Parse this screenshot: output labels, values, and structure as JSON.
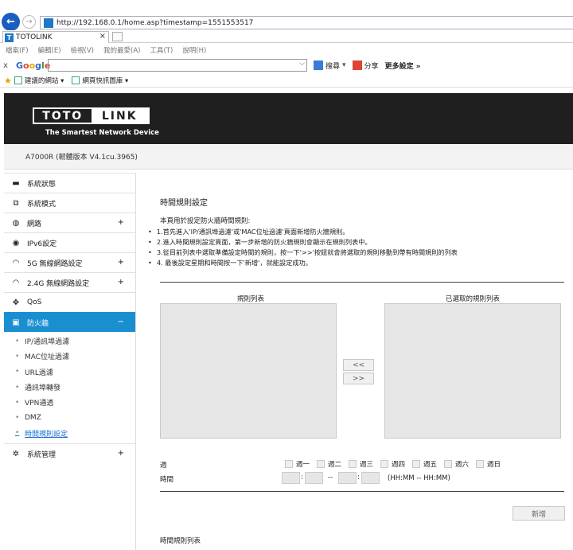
{
  "browser": {
    "url": "http://192.168.0.1/home.asp?timestamp=1551553517",
    "tab_title": "TOTOLINK",
    "tab_icon": "T",
    "tab_close": "×",
    "menu": [
      "檔案(F)",
      "編輯(E)",
      "檢視(V)",
      "我的最愛(A)",
      "工具(T)",
      "說明(H)"
    ],
    "google": {
      "close": "x",
      "logo": [
        "G",
        "o",
        "o",
        "g",
        "l",
        "e"
      ],
      "search_value": "",
      "search_label": "搜尋",
      "share_label": "分享",
      "more_label": "更多設定 »"
    },
    "favorites": [
      "建議的網站 ▾",
      "網頁快訊圖庫 ▾"
    ]
  },
  "router": {
    "logo_left": "TOTO",
    "logo_right": "LINK",
    "tagline": "The Smartest Network Device",
    "model": "A7000R (韌體版本 V4.1cu.3965)"
  },
  "sidebar": {
    "items": [
      {
        "label": "系統狀態",
        "icon": "chat-icon",
        "glyph": "▬",
        "plus": ""
      },
      {
        "label": "系統模式",
        "icon": "windows-icon",
        "glyph": "⧉",
        "plus": ""
      },
      {
        "label": "網路",
        "icon": "globe-icon",
        "glyph": "◍",
        "plus": "+"
      },
      {
        "label": "IPv6設定",
        "icon": "ipv6-icon",
        "glyph": "◉",
        "plus": ""
      },
      {
        "label": "5G 無線網路設定",
        "icon": "wifi-icon",
        "glyph": "◠",
        "plus": "+"
      },
      {
        "label": "2.4G 無線網路設定",
        "icon": "wifi-icon",
        "glyph": "◠",
        "plus": "+"
      },
      {
        "label": "QoS",
        "icon": "qos-icon",
        "glyph": "✥",
        "plus": ""
      },
      {
        "label": "防火牆",
        "icon": "lock-icon",
        "glyph": "▣",
        "plus": "−"
      }
    ],
    "subitems": [
      "IP/通訊埠過濾",
      "MAC位址過濾",
      "URL過濾",
      "通訊埠轉發",
      "VPN通透",
      "DMZ",
      "時間規則設定"
    ],
    "bottom_item": {
      "label": "系統管理",
      "icon": "gear-icon",
      "glyph": "✲",
      "plus": "+"
    }
  },
  "content": {
    "title": "時間規則設定",
    "intro": "本頁用於設定防火牆時間規則:",
    "steps": [
      "1.首先進入'IP/通訊埠過濾'或'MAC位址過濾'頁面新增防火牆規則。",
      "2.進入時間規則設定頁面，第一步新增的防火牆規則會顯示在規則列表中。",
      "3.從目前列表中選取準備設定時間的規則，按一下'>>'按鈕就會將選取的規則移動到帶有時間規則的列表",
      "4. 最後設定星期和時間按一下'新增'，就能設定成功。"
    ],
    "rule_list_title": "規則列表",
    "selected_list_title": "已選取的規則列表",
    "move_left": "<<",
    "move_right": ">>",
    "week_label": "週",
    "days": [
      "週一",
      "週二",
      "週三",
      "週四",
      "週五",
      "週六",
      "週日"
    ],
    "time_label": "時間",
    "time_colon": ":",
    "time_dash": "--",
    "time_hint": "(HH:MM -- HH:MM)",
    "add_button": "新增",
    "table_title": "時間規則列表"
  },
  "colors": {
    "accent": "#1a8fd0",
    "header_bg": "#1f1f1f",
    "back_button": "#1a5ebf"
  }
}
